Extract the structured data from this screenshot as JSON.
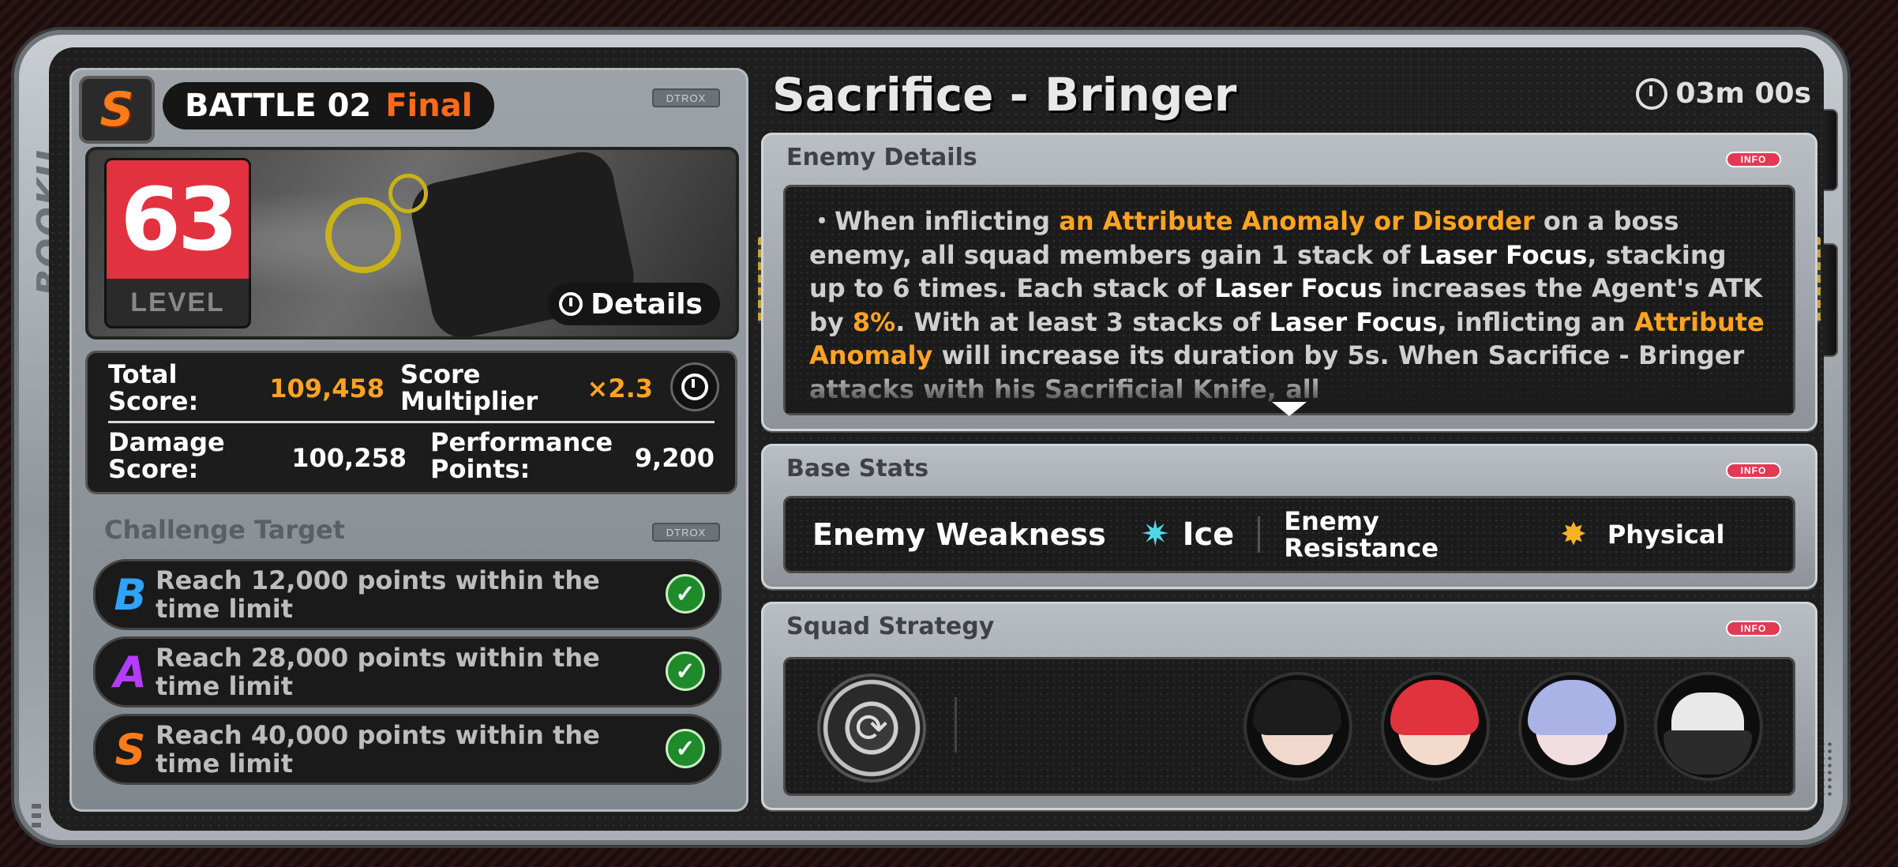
{
  "device": {
    "side_text": "BOOKU"
  },
  "left": {
    "rank_badge": "S",
    "battle": {
      "label": "BATTLE 02",
      "stage": "Final"
    },
    "chip_label": "DTROX",
    "level": {
      "value": "63",
      "label": "LEVEL"
    },
    "details_label": "Details",
    "scores": {
      "total_label": "Total Score:",
      "total_value": "109,458",
      "multiplier_label": "Score Multiplier",
      "multiplier_value": "×2.3",
      "damage_label": "Damage Score:",
      "damage_value": "100,258",
      "performance_label": "Performance Points:",
      "performance_value": "9,200"
    },
    "challenge_title": "Challenge Target",
    "targets": [
      {
        "grade": "B",
        "text": "Reach 12,000 points within the time limit",
        "color": "#2ea3ff"
      },
      {
        "grade": "A",
        "text": "Reach 28,000 points within the time limit",
        "color": "#b33cff"
      },
      {
        "grade": "S",
        "text": "Reach 40,000 points within the time limit",
        "color": "#ff7a1a"
      }
    ]
  },
  "right": {
    "title": "Sacrifice - Bringer",
    "timer": "03m 00s",
    "info_label": "INFO",
    "enemy_details": {
      "title": "Enemy Details",
      "p1": "・When inflicting ",
      "h1": "an Attribute Anomaly or Disorder",
      "p2": " on a boss enemy, all squad members gain 1 stack of ",
      "w1": "Laser Focus",
      "p3": ", stacking up to 6 times. Each stack of ",
      "w2": "Laser Focus",
      "p4": " increases the Agent's ATK by ",
      "h2": "8%",
      "p5": ". With at least 3 stacks of ",
      "w3": "Laser Focus",
      "p6": ", inflicting an ",
      "h3": "Attribute Anomaly",
      "p7": " will increase its duration by 5s. When Sacrifice - Bringer attacks with his Sacrificial Knife, all"
    },
    "base_stats": {
      "title": "Base Stats",
      "weakness_label": "Enemy Weakness",
      "weakness_value": "Ice",
      "resistance_label": "Enemy Resistance",
      "resistance_value": "Physical"
    },
    "squad": {
      "title": "Squad Strategy",
      "members": [
        "agent-1",
        "agent-2",
        "agent-3",
        "agent-4"
      ]
    }
  },
  "colors": {
    "accent_orange": "#ffa323",
    "rank_s": "#ff7a1a",
    "level_red": "#e23240",
    "info_pink": "#e23a55"
  }
}
